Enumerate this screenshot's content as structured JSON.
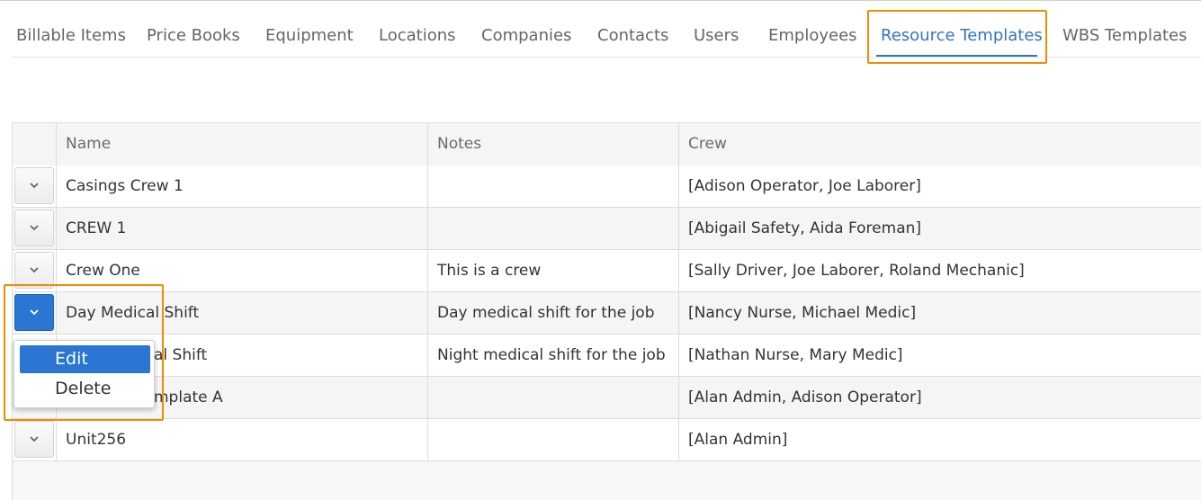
{
  "tabs": {
    "items": [
      {
        "label": "Billable Items"
      },
      {
        "label": "Price Books"
      },
      {
        "label": "Equipment"
      },
      {
        "label": "Locations"
      },
      {
        "label": "Companies"
      },
      {
        "label": "Contacts"
      },
      {
        "label": "Users"
      },
      {
        "label": "Employees"
      },
      {
        "label": "Resource Templates"
      },
      {
        "label": "WBS Templates"
      }
    ],
    "active": "Resource Templates"
  },
  "grid": {
    "columns": {
      "name": "Name",
      "notes": "Notes",
      "crew": "Crew"
    },
    "rows": [
      {
        "name": "Casings Crew 1",
        "notes": "",
        "crew": "[Adison Operator, Joe Laborer]"
      },
      {
        "name": "CREW 1",
        "notes": "",
        "crew": "[Abigail Safety, Aida Foreman]"
      },
      {
        "name": "Crew One",
        "notes": "This is a crew",
        "crew": "[Sally Driver, Joe Laborer, Roland Mechanic]"
      },
      {
        "name": "Day Medical Shift",
        "notes": "Day medical shift for the job",
        "crew": "[Nancy Nurse, Michael Medic]"
      },
      {
        "name": "al Shift",
        "notes": "Night medical shift for the job",
        "crew": "[Nathan Nurse, Mary Medic]"
      },
      {
        "name": "mplate A",
        "notes": "",
        "crew": "[Alan Admin, Adison Operator]"
      },
      {
        "name": "Unit256",
        "notes": "",
        "crew": "[Alan Admin]"
      }
    ]
  },
  "row_menu": {
    "items": [
      {
        "label": "Edit"
      },
      {
        "label": "Delete"
      }
    ]
  },
  "colors": {
    "accent": "#3273c6",
    "button_active": "#2a76d2",
    "highlight": "#f08c00"
  },
  "icons": {
    "expander": "chevron-down-icon"
  }
}
